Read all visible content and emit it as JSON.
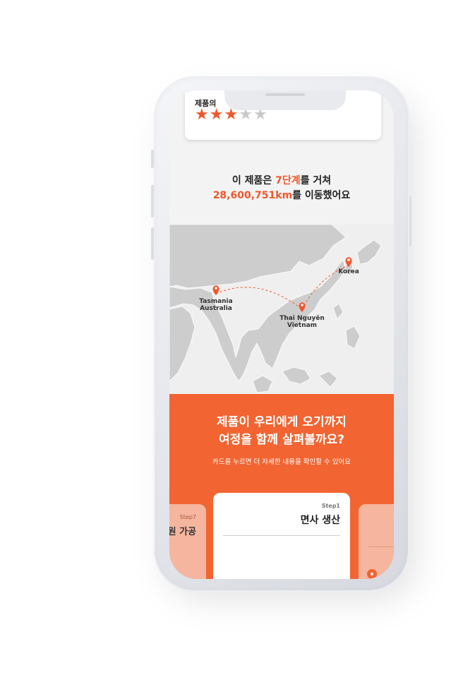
{
  "rating": {
    "label": "제품의",
    "filled_stars": 3,
    "total_stars": 5,
    "star_glyph": "★"
  },
  "headline": {
    "line1_prefix": "이 제품은 ",
    "line1_highlight": "7단계",
    "line1_suffix": "를 거쳐",
    "line2_highlight": "28,600,751km",
    "line2_suffix": "를 이동했어요"
  },
  "map": {
    "locations": [
      {
        "line1": "Tasmania",
        "line2": "Australia"
      },
      {
        "line1": "Thai Nguyên",
        "line2": "Vietnam"
      },
      {
        "line1": "Korea",
        "line2": ""
      }
    ],
    "route_color": "#f0572a",
    "land_color": "#cdcdcd"
  },
  "journey": {
    "title_line1": "제품이 우리에게 오기까지",
    "title_line2": "여정을 함께 살펴볼까요?",
    "subtitle": "카드를 누르면 더 자세한 내용을 확인할 수 있어요",
    "cards": [
      {
        "step": "Step7",
        "name": "원 가공"
      },
      {
        "step": "Step1",
        "name": "면사 생산"
      }
    ]
  },
  "colors": {
    "accent": "#f26431",
    "card_inactive": "#f6b59e"
  }
}
